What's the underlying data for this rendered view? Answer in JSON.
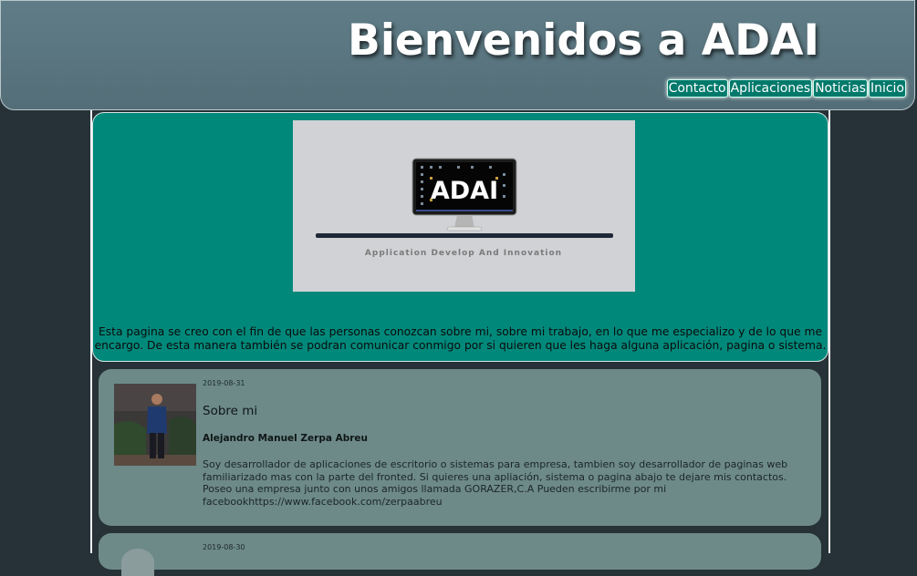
{
  "header": {
    "title": "Bienvenidos a ADAI",
    "nav": [
      "Contacto",
      "Aplicaciones",
      "Noticias",
      "Inicio"
    ]
  },
  "hero": {
    "logo_text": "ADAI",
    "logo_tagline": "Application Develop  And Innovation",
    "description": "Esta pagina se creo con el fin de que las personas conozcan sobre mi, sobre mi trabajo, en lo que me especializo y de lo que me encargo. De esta manera también se podran comunicar conmigo por si quieren que les haga alguna aplicación, pagina o sistema."
  },
  "posts": [
    {
      "date": "2019-08-31",
      "title": "Sobre mi",
      "author": "Alejandro Manuel Zerpa Abreu",
      "body": "Soy desarrollador de aplicaciones de escritorio o sistemas para empresa, tambien soy desarrollador de paginas web familiarizado mas con la parte del fronted. Si quieres una apliación, sistema o pagina abajo te dejare mis contactos. Poseo una empresa junto con unos amigos llamada GORAZER,C.A Pueden escribirme por mi facebookhttps://www.facebook.com/zerpaabreu"
    },
    {
      "date": "2019-08-30"
    }
  ],
  "colors": {
    "background": "#263238",
    "header": "#5a737c",
    "hero": "#00897b",
    "card": "#6d8a88",
    "nav_button": "#00796b"
  }
}
